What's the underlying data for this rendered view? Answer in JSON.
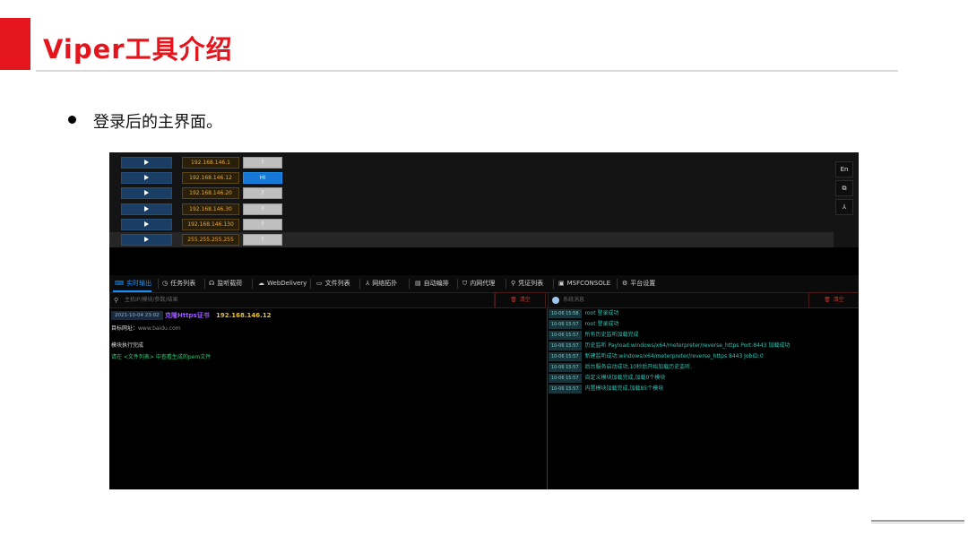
{
  "slide": {
    "title": "Viper工具介绍",
    "bullet": "登录后的主界面。"
  },
  "hosts": [
    {
      "ip": "192.168.146.1",
      "tag": "?",
      "active": false,
      "selected": false
    },
    {
      "ip": "192.168.146.12",
      "tag": "HI",
      "active": true,
      "selected": false
    },
    {
      "ip": "192.168.146.20",
      "tag": "?",
      "active": false,
      "selected": false
    },
    {
      "ip": "192.168.146.30",
      "tag": "?",
      "active": false,
      "selected": false
    },
    {
      "ip": "192.168.146.130",
      "tag": "?",
      "active": false,
      "selected": false
    },
    {
      "ip": "255.255.255.255",
      "tag": "?",
      "active": false,
      "selected": true
    }
  ],
  "side_buttons": [
    "En",
    "⧉",
    "⅄"
  ],
  "tabs": [
    {
      "label": "实时输出",
      "icon": "⌨",
      "active": true
    },
    {
      "label": "任务列表",
      "icon": "◷",
      "active": false
    },
    {
      "label": "监听载荷",
      "icon": "☊",
      "active": false
    },
    {
      "label": "WebDelivery",
      "icon": "☁",
      "active": false
    },
    {
      "label": "文件列表",
      "icon": "▭",
      "active": false
    },
    {
      "label": "网络拓扑",
      "icon": "⅄",
      "active": false
    },
    {
      "label": "自动编排",
      "icon": "▤",
      "active": false
    },
    {
      "label": "内网代理",
      "icon": "⛉",
      "active": false
    },
    {
      "label": "凭证列表",
      "icon": "⚲",
      "active": false
    },
    {
      "label": "MSFCONSOLE",
      "icon": "▣",
      "active": false
    },
    {
      "label": "平台设置",
      "icon": "⚙",
      "active": false
    }
  ],
  "left_search": {
    "placeholder": "主机IP/模块/参数/结果",
    "clear_label": "清空"
  },
  "right_panel": {
    "label": "系统消息",
    "clear_label": "清空"
  },
  "left_log": {
    "time": "2021-10-04 23:02",
    "cert_label": "克隆Https证书",
    "ip": "192.168.146.12",
    "target_label": "目标网址：",
    "target_url": "www.baidu.com",
    "done_text": "模块执行完成",
    "hint_text": "请在 <文件列表> 中查看生成的pem文件"
  },
  "right_log": [
    {
      "time": "10-06 15:58",
      "msg": "root 登录成功"
    },
    {
      "time": "10-06 15:57",
      "msg": "root 登录成功"
    },
    {
      "time": "10-06 15:57",
      "msg": "所有历史监听加载完成"
    },
    {
      "time": "10-06 15:57",
      "msg": "历史监听 Payload:windows/x64/meterpreter/reverse_https Port:8443 加载成功"
    },
    {
      "time": "10-06 15:57",
      "msg": "新建监听成功:windows/x64/meterpreter/reverse_https 8443 JobID:0"
    },
    {
      "time": "10-06 15:57",
      "msg": "后台服务启动成功,10秒后开始加载历史监听."
    },
    {
      "time": "10-06 15:57",
      "msg": "自定义模块加载完成,加载0个模块"
    },
    {
      "time": "10-06 15:57",
      "msg": "内置模块加载完成,加载85个模块"
    }
  ]
}
